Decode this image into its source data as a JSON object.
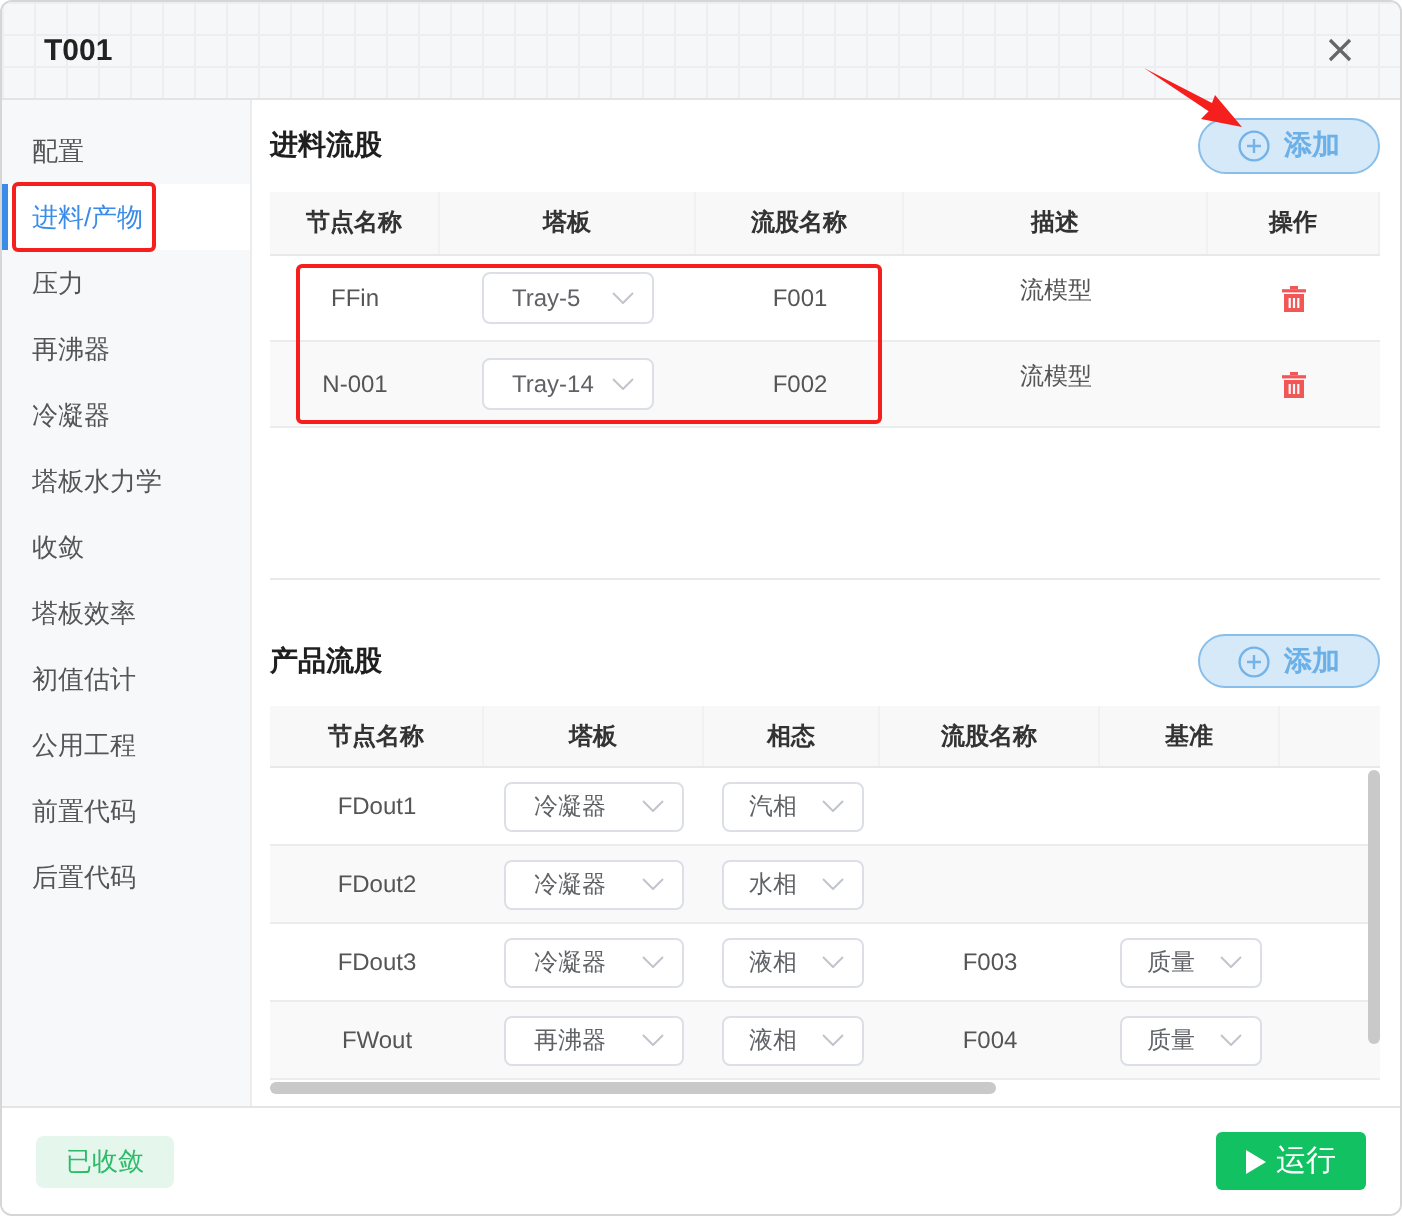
{
  "dialog": {
    "title": "T001"
  },
  "sidebar": {
    "items": [
      {
        "label": "配置",
        "selected": false
      },
      {
        "label": "进料/产物",
        "selected": true
      },
      {
        "label": "压力",
        "selected": false
      },
      {
        "label": "再沸器",
        "selected": false
      },
      {
        "label": "冷凝器",
        "selected": false
      },
      {
        "label": "塔板水力学",
        "selected": false
      },
      {
        "label": "收敛",
        "selected": false
      },
      {
        "label": "塔板效率",
        "selected": false
      },
      {
        "label": "初值估计",
        "selected": false
      },
      {
        "label": "公用工程",
        "selected": false
      },
      {
        "label": "前置代码",
        "selected": false
      },
      {
        "label": "后置代码",
        "selected": false
      }
    ]
  },
  "feed_streams": {
    "title": "进料流股",
    "add_button": "添加",
    "columns": [
      "节点名称",
      "塔板",
      "流股名称",
      "描述",
      "操作"
    ],
    "rows": [
      {
        "node_name": "FFin",
        "tray": "Tray-5",
        "stream_name": "F001",
        "description": "流模型"
      },
      {
        "node_name": "N-001",
        "tray": "Tray-14",
        "stream_name": "F002",
        "description": "流模型"
      }
    ]
  },
  "product_streams": {
    "title": "产品流股",
    "add_button": "添加",
    "columns": [
      "节点名称",
      "塔板",
      "相态",
      "流股名称",
      "基准"
    ],
    "rows": [
      {
        "node_name": "FDout1",
        "tray": "冷凝器",
        "phase": "汽相"
      },
      {
        "node_name": "FDout2",
        "tray": "冷凝器",
        "phase": "水相"
      },
      {
        "node_name": "FDout3",
        "tray": "冷凝器",
        "phase": "液相",
        "stream_name": "F003",
        "basis": "质量"
      },
      {
        "node_name": "FWout",
        "tray": "再沸器",
        "phase": "液相",
        "stream_name": "F004",
        "basis": "质量"
      }
    ]
  },
  "footer": {
    "status": "已收敛",
    "run_button": "运行"
  }
}
